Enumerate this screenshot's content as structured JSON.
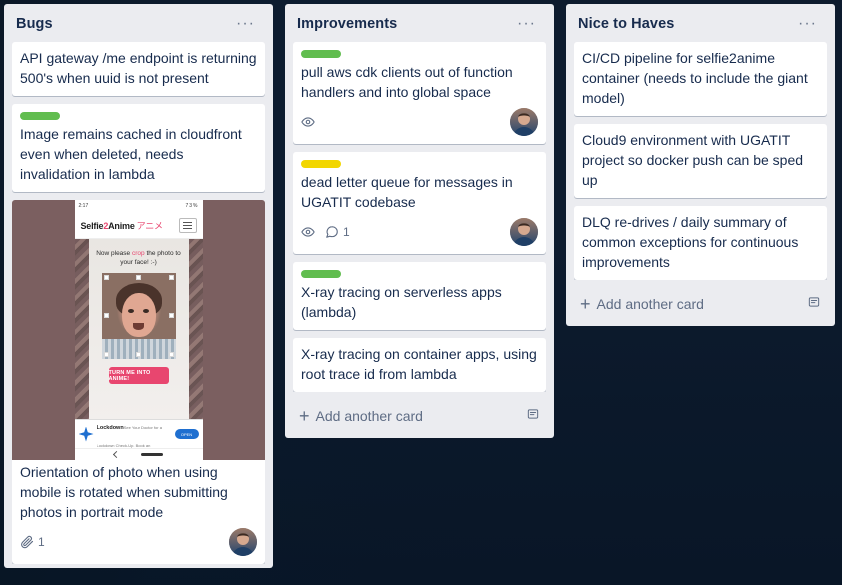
{
  "board": {
    "background_color": "#1b5283",
    "list_background": "#ebecf0",
    "card_background": "#ffffff",
    "text_color": "#172b4d",
    "muted_text_color": "#5e6c84"
  },
  "labels": {
    "green": "#61bd4f",
    "yellow": "#f2d600"
  },
  "lists": [
    {
      "title": "Bugs",
      "menu_icon": "ellipsis-icon",
      "menu_label": "···",
      "cards": [
        {
          "title": "API gateway /me endpoint is returning 500's when uuid is not present",
          "labels": [],
          "badges": [],
          "members": [],
          "cover": null
        },
        {
          "title": "Image remains cached in cloudfront even when deleted, needs invalidation in lambda",
          "labels": [
            "green"
          ],
          "badges": [],
          "members": [],
          "cover": null
        },
        {
          "title": "Orientation of photo when using mobile is rotated when submitting photos in portrait mode",
          "labels": [],
          "badges": [
            {
              "icon": "attachment-icon",
              "value": "1"
            }
          ],
          "members": [
            "member-avatar"
          ],
          "cover": {
            "type": "image",
            "alt": "Selfie2Anime mobile app screenshot",
            "background_color": "#7b5f60",
            "phone": {
              "status_time": "2:17",
              "status_battery": "73%",
              "brand_name": "Selfie",
              "brand_accent": "2",
              "brand_suffix": "Anime",
              "brand_japanese": "アニメ",
              "prompt_before": "Now please ",
              "prompt_highlight": "crop",
              "prompt_after": " the photo to your face! :-)",
              "cta_label": "TURN ME INTO ANIME!",
              "ad_title": "Restart Well After Lockdown",
              "ad_subtitle": "See Your Doctor for a Lockdown Check-Up. Book an Appointment Today",
              "ad_button": "OPEN"
            }
          }
        }
      ],
      "add_card": {
        "label": "Add another card",
        "icon": "plus-icon",
        "template_icon": "card-template-icon"
      },
      "show_add_card": false
    },
    {
      "title": "Improvements",
      "menu_icon": "ellipsis-icon",
      "menu_label": "···",
      "cards": [
        {
          "title": "pull aws cdk clients out of function handlers and into global space",
          "labels": [
            "green"
          ],
          "badges": [
            {
              "icon": "watch-eye-icon",
              "value": ""
            }
          ],
          "members": [
            "member-avatar"
          ],
          "cover": null
        },
        {
          "title": "dead letter queue for messages in UGATIT codebase",
          "labels": [
            "yellow"
          ],
          "badges": [
            {
              "icon": "watch-eye-icon",
              "value": ""
            },
            {
              "icon": "comment-icon",
              "value": "1"
            }
          ],
          "members": [
            "member-avatar"
          ],
          "cover": null
        },
        {
          "title": "X-ray tracing on serverless apps (lambda)",
          "labels": [
            "green"
          ],
          "badges": [],
          "members": [],
          "cover": null
        },
        {
          "title": "X-ray tracing on container apps, using root trace id from lambda",
          "labels": [],
          "badges": [],
          "members": [],
          "cover": null
        }
      ],
      "add_card": {
        "label": "Add another card",
        "icon": "plus-icon",
        "template_icon": "card-template-icon"
      },
      "show_add_card": true
    },
    {
      "title": "Nice to Haves",
      "menu_icon": "ellipsis-icon",
      "menu_label": "···",
      "cards": [
        {
          "title": "CI/CD pipeline for selfie2anime container (needs to include the giant model)",
          "labels": [],
          "badges": [],
          "members": [],
          "cover": null
        },
        {
          "title": "Cloud9 environment with UGATIT project so docker push can be sped up",
          "labels": [],
          "badges": [],
          "members": [],
          "cover": null
        },
        {
          "title": "DLQ re-drives / daily summary of common exceptions for continuous improvements",
          "labels": [],
          "badges": [],
          "members": [],
          "cover": null
        }
      ],
      "add_card": {
        "label": "Add another card",
        "icon": "plus-icon",
        "template_icon": "card-template-icon"
      },
      "show_add_card": true
    }
  ]
}
